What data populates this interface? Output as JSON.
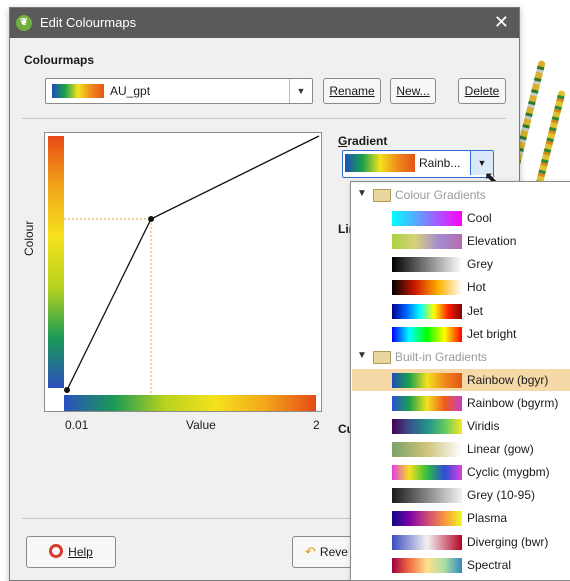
{
  "window": {
    "title": "Edit Colourmaps",
    "close_glyph": "✕"
  },
  "colourmaps": {
    "label": "Colourmaps",
    "selected": "AU_gpt",
    "rename_label": "Rename",
    "new_label": "New...",
    "delete_label": "Delete"
  },
  "plot": {
    "y_label": "Colour",
    "x_label": "Value",
    "x_min_label": "0.01",
    "x_max_label": "2"
  },
  "gradient": {
    "label": "Gradient",
    "selected": "Rainb...",
    "partial_labels": {
      "lin": "Lin",
      "cu": "Cu"
    }
  },
  "dropdown": {
    "groups": [
      {
        "name": "Colour Gradients",
        "items": [
          {
            "name": "Cool",
            "colors": [
              "#00ffff",
              "#ff00ff"
            ]
          },
          {
            "name": "Elevation",
            "colors": [
              "#a9d33f",
              "#d8d07a",
              "#a58bd0",
              "#b46cb0"
            ]
          },
          {
            "name": "Grey",
            "colors": [
              "#000000",
              "#ffffff"
            ]
          },
          {
            "name": "Hot",
            "colors": [
              "#000000",
              "#d11a00",
              "#ffb300",
              "#ffffff"
            ]
          },
          {
            "name": "Jet",
            "colors": [
              "#00008f",
              "#0060ff",
              "#00ffff",
              "#ffff00",
              "#ff2000",
              "#800000"
            ]
          },
          {
            "name": "Jet bright",
            "colors": [
              "#0000ff",
              "#00ffff",
              "#00ff00",
              "#ffff00",
              "#ff0000"
            ]
          }
        ]
      },
      {
        "name": "Built-in Gradients",
        "items": [
          {
            "name": "Rainbow (bgyr)",
            "colors": [
              "#1f4fb8",
              "#1aa14a",
              "#f5e21d",
              "#f08a1c",
              "#e25617"
            ],
            "selected": true
          },
          {
            "name": "Rainbow (bgyrm)",
            "colors": [
              "#2a4fd4",
              "#1aa14a",
              "#f5e21d",
              "#ef5b1c",
              "#c73fc7"
            ]
          },
          {
            "name": "Viridis",
            "colors": [
              "#440154",
              "#3b528b",
              "#21918c",
              "#5ec962",
              "#fde725"
            ]
          },
          {
            "name": "Linear (gow)",
            "colors": [
              "#7aa36a",
              "#cfc47a",
              "#ffffff"
            ]
          },
          {
            "name": "Cyclic (mygbm)",
            "colors": [
              "#e03fe0",
              "#f5e21d",
              "#2fbf3f",
              "#2b4fd4",
              "#e03fe0"
            ]
          },
          {
            "name": "Grey (10-95)",
            "colors": [
              "#1a1a1a",
              "#f2f2f2"
            ]
          },
          {
            "name": "Plasma",
            "colors": [
              "#0d0887",
              "#7e03a8",
              "#cc4778",
              "#f89540",
              "#f0f921"
            ]
          },
          {
            "name": "Diverging (bwr)",
            "colors": [
              "#3b4cc0",
              "#f2f2f2",
              "#b40426"
            ]
          },
          {
            "name": "Spectral",
            "colors": [
              "#9e0142",
              "#f46d43",
              "#fee08b",
              "#abdda4",
              "#3288bd"
            ]
          }
        ]
      }
    ]
  },
  "footer": {
    "help_label": "Help",
    "revert_label": "Reve"
  },
  "icons": {
    "app": "leaf-icon",
    "help": "lifebuoy-icon",
    "revert": "revert-icon"
  }
}
